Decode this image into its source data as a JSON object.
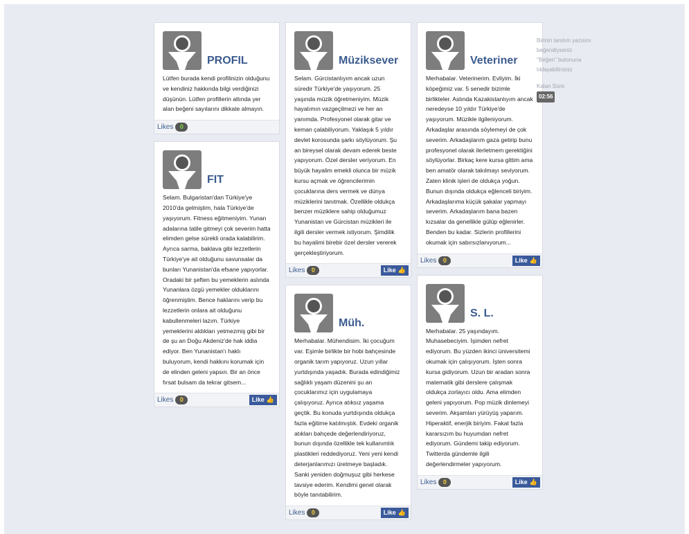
{
  "side": {
    "info": "Birinin tanıtım yazısını beğendiyseniz \"Beğen\" butonuna tıklayabilirsiniz",
    "timer_label": "Kalan Süre:",
    "timer_value": "02:56"
  },
  "like_label": "Like",
  "likes_label": "Likes",
  "profiles": {
    "profil": {
      "name": "PROFIL",
      "bio": "Lütfen burada kendi profilinizin olduğunu ve kendiniz hakkında bilgi verdiğinizi düşünün. Lütfen profillerin altında yer alan beğeni sayılarını dikkate almayın.",
      "likes": "0"
    },
    "fit": {
      "name": "FIT",
      "bio": "Selam. Bulgaristan'dan Türkiye'ye 2010'da gelmiştim, hala Türkiye'de yaşıyorum. Fitness eğitmeniyim. Yunan adalarına tatile gitmeyi çok severim hatta elimden gelse sürekli orada kalabilirim. Ayrıca sarma, baklava gibi lezzetlerin Türkiye'ye ait olduğunu savunsalar da bunları Yunanistan'da efsane yapıyorlar. Oradaki bir şeften bu yemeklerin aslında Yunanlara özgü yemekler olduklarını öğrenmiştim. Bence haklarını verip bu lezzetlerin onlara ait olduğunu kabullenmeleri lazım. Türkiye yemeklerini aldıkları yetmezmiş gibi bir de şu an Doğu Akdeniz'de hak iddia ediyor. Ben Yunanistan'ı haklı buluyorum, kendi hakkını korumak için de elinden geleni yapsın. Bir an önce fırsat bulsam da tekrar gitsem...",
      "likes": "0"
    },
    "muziksever": {
      "name": "Müziksever",
      "bio": "Selam. Gürcistanlıyım ancak uzun süredir Türkiye'de yaşıyorum. 25 yaşında müzik öğretmeniyim. Müzik hayatımın vazgeçilmezi ve her an yanımda. Profesyonel olarak gitar ve keman çalabiliyorum. Yaklaşık 5 yıldır devlet korosunda şarkı söylüyorum. Şu an bireysel olarak devam ederek beste yapıyorum. Özel dersler veriyorum. En büyük hayalim emekli olunca bir müzik kursu açmak ve öğrencilerimin çocuklarına ders vermek ve dünya müziklerini tanıtmak. Özellikle oldukça benzer müziklere sahip olduğumuz Yunanistan ve Gürcistan müzikleri ile ilgili dersler vermek istiyorum. Şimdilik bu hayalimi birebir özel dersler vererek gerçekleştiriyorum.",
      "likes": "0"
    },
    "muh": {
      "name": "Müh.",
      "bio": "Merhabalar. Mühendisim. İki çocuğum var. Eşimle birlikte bir hobi bahçesinde organik tarım yapıyoruz. Uzun yıllar yurtdışında yaşadık. Burada edindiğimiz sağlıklı yaşam düzenini şu an çocuklarımız için uygulamaya çalışıyoruz. Ayrıca atıksız yaşama geçtik. Bu konuda yurtdışında oldukça fazla eğitime katılmıştık. Evdeki organik atıkları bahçede değerlendiriyoruz, bunun dışında özellikle tek kullanımlık plastikleri reddediyoruz. Yeni yeni kendi deterjanlarımızı üretmeye başladık. Sanki yeniden doğmuşuz gibi herkese tavsiye ederim. Kendimi genel olarak böyle tanıtabilirim.",
      "likes": "0"
    },
    "veteriner": {
      "name": "Veteriner",
      "bio": "Merhabalar. Veterinerim. Evliyim. İki köpeğimiz var. 5 senedir bizimle birlikteler. Aslında Kazakistanlıyım ancak neredeyse 10 yıldır Türkiye'de yaşıyorum. Müzikle ilgileniyorum. Arkadaşlar arasında söylemeyi de çok severim. Arkadaşlarım gaza getirip bunu profesyonel olarak ilerletmem gerektiğini söylüyorlar. Birkaç kere kursa gittim ama ben amatör olarak takılmayı seviyorum. Zaten klinik işleri de oldukça yoğun. Bunun dışında oldukça eğlenceli biriyim. Arkadaşlarıma küçük şakalar yapmayı severim. Arkadaşlarım bana bazen kızsalar da genellikle gülüp eğlenirler. Benden bu kadar. Sizlerin profillerini okumak için sabırsızlanıyorum...",
      "likes": "0"
    },
    "sl": {
      "name": "S. L.",
      "bio": "Merhabalar. 25 yaşındayım. Muhasebeciyim. İşimden nefret ediyorum. Bu yüzden ikinci üniversitemi okumak için çalışıyorum. İşten sonra kursa gidiyorum. Uzun bir aradan sonra matematik gibi derslere çalışmak oldukça zorlayıcı oldu. Ama elimden geleni yapıyorum. Pop müzik dinlemeyi severim. Akşamları yürüyüş yaparım. Hiperaktif, enerjik biriyim. Fakat fazla kararsızım bu huyumdan nefret ediyorum. Gündemi takip ediyorum. Twitterda gündemle ilgili değerlendirmeler yapıyorum.",
      "likes": "0"
    }
  }
}
